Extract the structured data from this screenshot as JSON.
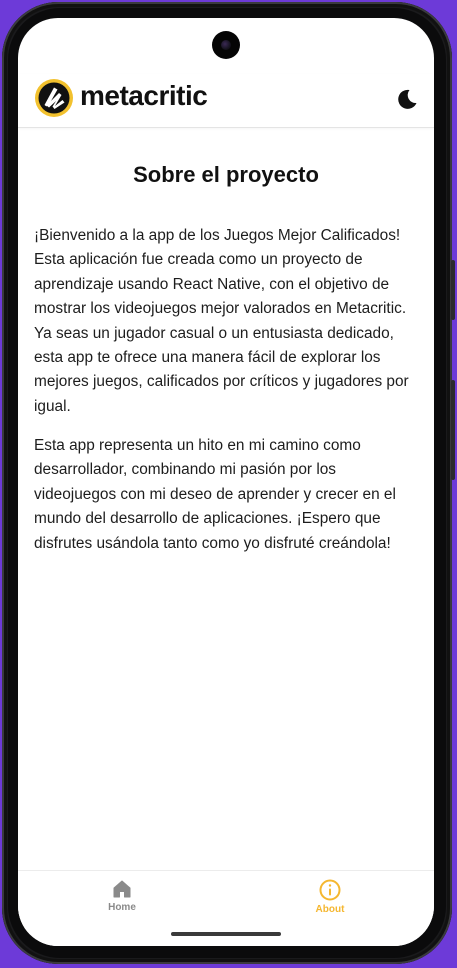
{
  "app": {
    "logo_text": "metacritic"
  },
  "page": {
    "title": "Sobre el proyecto",
    "paragraphs": [
      "¡Bienvenido a la app de los Juegos Mejor Calificados! Esta aplicación fue creada como un proyecto de aprendizaje usando React Native, con el objetivo de mostrar los videojuegos mejor valorados en Metacritic. Ya seas un jugador casual o un entusiasta dedicado, esta app te ofrece una manera fácil de explorar los mejores juegos, calificados por críticos y jugadores por igual.",
      "Esta app representa un hito en mi camino como desarrollador, combinando mi pasión por los videojuegos con mi deseo de aprender y crecer en el mundo del desarrollo de aplicaciones. ¡Espero que disfrutes usándola tanto como yo disfruté creándola!"
    ]
  },
  "tabs": [
    {
      "label": "Home",
      "icon": "home-icon",
      "active": false
    },
    {
      "label": "About",
      "icon": "info-icon",
      "active": true
    }
  ],
  "colors": {
    "accent": "#f5b730",
    "inactive": "#8a8a8a",
    "logo_ring": "#f2c12e",
    "background": "#6d3ad8"
  }
}
